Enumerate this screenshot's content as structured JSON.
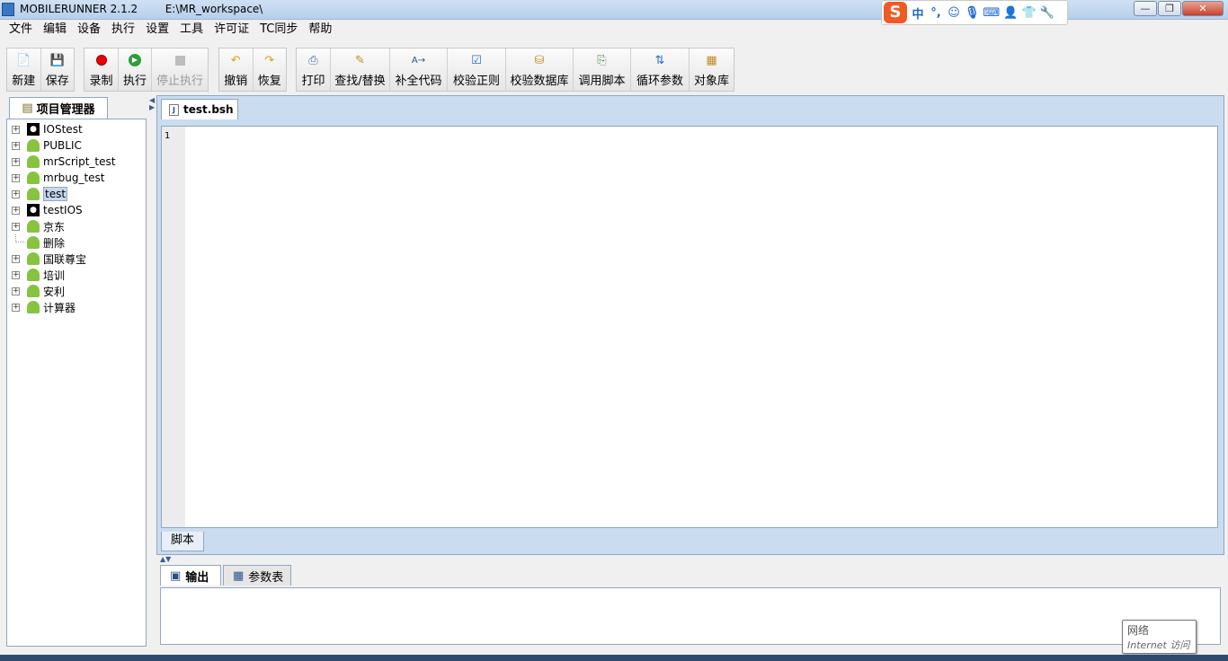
{
  "window": {
    "title": "MOBILERUNNER 2.1.2        E:\\MR_workspace\\",
    "min_label": "—",
    "max_label": "❐",
    "close_label": "✕"
  },
  "ime": {
    "logo": "S",
    "mode": "中",
    "punct": "°,"
  },
  "menu": [
    "文件",
    "编辑",
    "设备",
    "执行",
    "设置",
    "工具",
    "许可证",
    "TC同步",
    "帮助"
  ],
  "toolbar": {
    "new": "新建",
    "save": "保存",
    "record": "录制",
    "run": "执行",
    "stop": "停止执行",
    "undo": "撤销",
    "redo": "恢复",
    "print": "打印",
    "find_replace": "查找/替换",
    "complete_code": "补全代码",
    "check_regex": "校验正则",
    "check_db": "校验数据库",
    "call_script": "调用脚本",
    "loop_params": "循环参数",
    "object_repo": "对象库"
  },
  "project_panel": {
    "tab": "项目管理器",
    "tree": [
      {
        "label": "IOStest",
        "icon": "apple-icon",
        "expandable": true,
        "selected": false
      },
      {
        "label": "PUBLIC",
        "icon": "android-icon",
        "expandable": true,
        "selected": false
      },
      {
        "label": "mrScript_test",
        "icon": "android-icon",
        "expandable": true,
        "selected": false
      },
      {
        "label": "mrbug_test",
        "icon": "android-icon",
        "expandable": true,
        "selected": false
      },
      {
        "label": "test",
        "icon": "android-icon",
        "expandable": true,
        "selected": true
      },
      {
        "label": "testIOS",
        "icon": "apple-icon",
        "expandable": true,
        "selected": false
      },
      {
        "label": "京东",
        "icon": "android-icon",
        "expandable": true,
        "selected": false
      },
      {
        "label": "删除",
        "icon": "android-icon",
        "expandable": false,
        "selected": false
      },
      {
        "label": "国联尊宝",
        "icon": "android-icon",
        "expandable": true,
        "selected": false
      },
      {
        "label": "培训",
        "icon": "android-icon",
        "expandable": true,
        "selected": false
      },
      {
        "label": "安利",
        "icon": "android-icon",
        "expandable": true,
        "selected": false
      },
      {
        "label": "计算器",
        "icon": "android-icon",
        "expandable": true,
        "selected": false
      }
    ]
  },
  "editor": {
    "tab": "test.bsh",
    "line_numbers": "1",
    "bottom_tab": "脚本"
  },
  "bottom": {
    "output_tab": "输出",
    "params_tab": "参数表"
  },
  "tooltip": {
    "title": "网络",
    "sub": "Internet 访问"
  }
}
